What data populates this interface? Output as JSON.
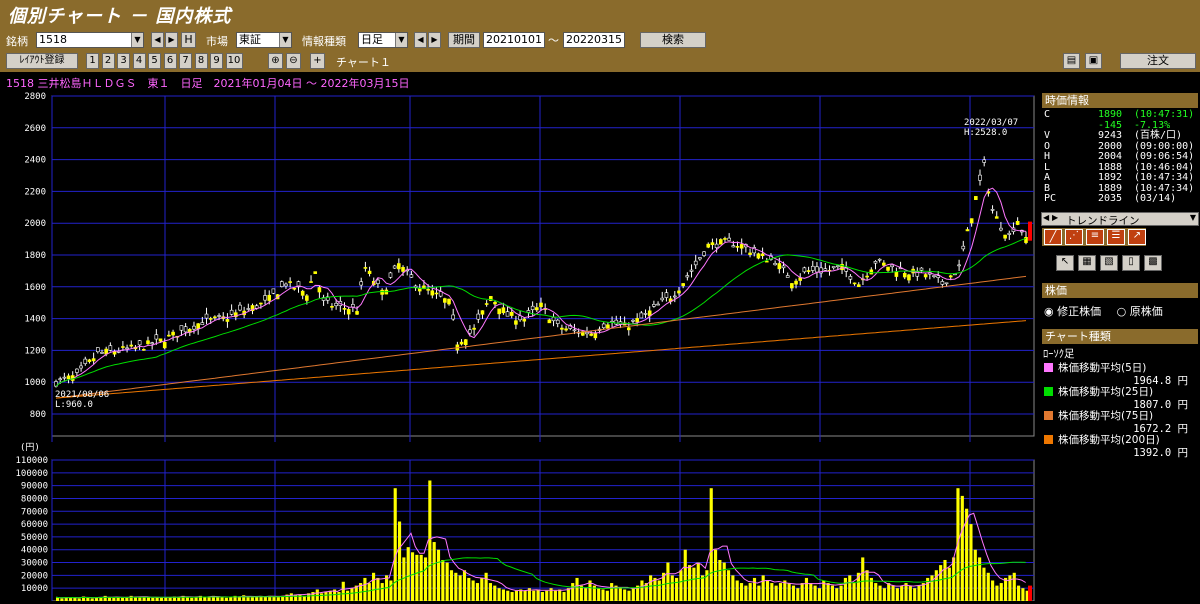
{
  "header": {
    "title": "個別チャート － 国内株式"
  },
  "controls": {
    "symbol_label": "銘柄",
    "symbol_value": "1518",
    "h_label": "H",
    "market_label": "市場",
    "market_value": "東証",
    "info_type_label": "情報種類",
    "info_type_value": "日足",
    "period_label": "期間",
    "from_date": "20210101",
    "tilde": "～",
    "to_date": "20220315",
    "search_label": "検索"
  },
  "toolbar": {
    "layout_label": "ﾚｲｱｳﾄ登録",
    "layout_numbers": [
      "1",
      "2",
      "3",
      "4",
      "5",
      "6",
      "7",
      "8",
      "9",
      "10"
    ],
    "chart_label": "チャート１",
    "order_label": "注文"
  },
  "info_line": "1518 三井松島ＨＬＤＧＳ　東１　日足　2021年01月04日 ～ 2022年03月15日",
  "quote": {
    "header": "時価情報",
    "rows": [
      {
        "k": "C",
        "v": "1890",
        "t": "(10:47:31)"
      },
      {
        "k": "",
        "v": "-145",
        "t": "-7.13%"
      },
      {
        "k": "V",
        "v": "9243",
        "t": "(百株/口)"
      },
      {
        "k": "O",
        "v": "2000",
        "t": "(09:00:00)"
      },
      {
        "k": "H",
        "v": "2004",
        "t": "(09:06:54)"
      },
      {
        "k": "L",
        "v": "1888",
        "t": "(10:46:04)"
      },
      {
        "k": "A",
        "v": "1892",
        "t": "(10:47:34)"
      },
      {
        "k": "B",
        "v": "1889",
        "t": "(10:47:34)"
      },
      {
        "k": "PC",
        "v": "2035",
        "t": "(03/14)"
      }
    ]
  },
  "trendline": {
    "label": "トレンドライン"
  },
  "price_type": {
    "header": "株価",
    "options": [
      "修正株価",
      "原株価"
    ],
    "selected": "修正株価"
  },
  "chart_kind": {
    "header": "チャート種類",
    "candle_label": "ﾛｰｿｸ足",
    "ma": [
      {
        "name": "株価移動平均(5日)",
        "value": "1964.8 円",
        "color": "#ff77ff"
      },
      {
        "name": "株価移動平均(25日)",
        "value": "1807.0 円",
        "color": "#00dd00"
      },
      {
        "name": "株価移動平均(75日)",
        "value": "1672.2 円",
        "color": "#e07830"
      },
      {
        "name": "株価移動平均(200日)",
        "value": "1392.0 円",
        "color": "#ee7700"
      }
    ]
  },
  "chart_data": {
    "type": "candlestick",
    "price_yaxis": {
      "min": 800,
      "max": 2800,
      "ticks": [
        800,
        1000,
        1200,
        1400,
        1600,
        1800,
        2000,
        2200,
        2400,
        2600,
        2800
      ]
    },
    "volume_yaxis": {
      "unit": "(円)",
      "min": 0,
      "max": 110000,
      "ticks": [
        10000,
        20000,
        30000,
        40000,
        50000,
        60000,
        70000,
        80000,
        90000,
        100000,
        110000
      ]
    },
    "annotations": [
      {
        "text": "2022/03/07",
        "text2": "H:2528.0"
      },
      {
        "text": "2021/08/06",
        "text2": "L:960.0"
      }
    ],
    "price_points": [
      [
        0,
        1000
      ],
      [
        5,
        1040
      ],
      [
        10,
        1180
      ],
      [
        15,
        1200
      ],
      [
        20,
        1220
      ],
      [
        25,
        1260
      ],
      [
        30,
        1320
      ],
      [
        35,
        1380
      ],
      [
        40,
        1400
      ],
      [
        45,
        1450
      ],
      [
        50,
        1500
      ],
      [
        55,
        1620
      ],
      [
        60,
        1560
      ],
      [
        62,
        1700
      ],
      [
        64,
        1500
      ],
      [
        68,
        1470
      ],
      [
        72,
        1460
      ],
      [
        74,
        1720
      ],
      [
        78,
        1560
      ],
      [
        82,
        1740
      ],
      [
        86,
        1620
      ],
      [
        90,
        1560
      ],
      [
        94,
        1500
      ],
      [
        96,
        1250
      ],
      [
        100,
        1330
      ],
      [
        104,
        1540
      ],
      [
        108,
        1420
      ],
      [
        112,
        1400
      ],
      [
        116,
        1480
      ],
      [
        120,
        1350
      ],
      [
        124,
        1320
      ],
      [
        128,
        1310
      ],
      [
        132,
        1380
      ],
      [
        136,
        1350
      ],
      [
        140,
        1400
      ],
      [
        144,
        1480
      ],
      [
        148,
        1560
      ],
      [
        152,
        1700
      ],
      [
        156,
        1860
      ],
      [
        160,
        1880
      ],
      [
        164,
        1860
      ],
      [
        168,
        1800
      ],
      [
        172,
        1760
      ],
      [
        176,
        1640
      ],
      [
        180,
        1700
      ],
      [
        184,
        1700
      ],
      [
        188,
        1720
      ],
      [
        192,
        1620
      ],
      [
        196,
        1760
      ],
      [
        200,
        1720
      ],
      [
        204,
        1690
      ],
      [
        208,
        1680
      ],
      [
        212,
        1620
      ],
      [
        216,
        1720
      ],
      [
        220,
        2160
      ],
      [
        222,
        2360
      ],
      [
        224,
        2080
      ],
      [
        226,
        1980
      ],
      [
        228,
        1920
      ],
      [
        230,
        2020
      ],
      [
        232,
        1890
      ]
    ],
    "volume_values": [
      3000,
      2000,
      3000,
      2500,
      3000,
      2000,
      3500,
      3000,
      2000,
      2500,
      3000,
      4000,
      3000,
      2500,
      3000,
      2500,
      3000,
      4000,
      3000,
      3500,
      3000,
      3000,
      2500,
      3000,
      2500,
      3000,
      3000,
      3500,
      3000,
      4000,
      3000,
      2500,
      3000,
      4000,
      3000,
      3500,
      4000,
      3000,
      3000,
      2500,
      3000,
      4000,
      3500,
      4500,
      3000,
      3000,
      3500,
      4000,
      3500,
      4000,
      3500,
      3000,
      4000,
      5000,
      6000,
      5000,
      5000,
      4000,
      6000,
      7000,
      9000,
      6000,
      7000,
      8000,
      9000,
      7000,
      15000,
      8000,
      10000,
      12000,
      14000,
      18000,
      14000,
      22000,
      18000,
      14000,
      20000,
      16000,
      88000,
      62000,
      34000,
      42000,
      38000,
      36000,
      36000,
      34000,
      94000,
      46000,
      40000,
      32000,
      30000,
      24000,
      22000,
      20000,
      24000,
      18000,
      16000,
      14000,
      18000,
      22000,
      14000,
      12000,
      10000,
      9000,
      8000,
      7000,
      8000,
      9000,
      8000,
      10000,
      8000,
      9000,
      7000,
      8000,
      10000,
      8000,
      9000,
      7000,
      10000,
      14000,
      18000,
      12000,
      10000,
      16000,
      12000,
      10000,
      9000,
      8000,
      14000,
      12000,
      10000,
      9000,
      8000,
      10000,
      12000,
      16000,
      14000,
      20000,
      18000,
      16000,
      22000,
      30000,
      20000,
      18000,
      24000,
      40000,
      28000,
      26000,
      30000,
      20000,
      24000,
      88000,
      40000,
      32000,
      30000,
      24000,
      20000,
      16000,
      14000,
      12000,
      14000,
      18000,
      12000,
      20000,
      16000,
      14000,
      12000,
      14000,
      16000,
      14000,
      12000,
      10000,
      14000,
      18000,
      14000,
      12000,
      10000,
      16000,
      14000,
      12000,
      10000,
      12000,
      18000,
      20000,
      14000,
      22000,
      34000,
      24000,
      18000,
      14000,
      12000,
      10000,
      14000,
      12000,
      10000,
      12000,
      14000,
      12000,
      10000,
      12000,
      14000,
      18000,
      20000,
      24000,
      28000,
      32000,
      26000,
      34000,
      88000,
      82000,
      72000,
      60000,
      40000,
      34000,
      26000,
      22000,
      16000,
      12000,
      14000,
      18000,
      20000,
      22000,
      12000,
      10000,
      8000
    ]
  }
}
